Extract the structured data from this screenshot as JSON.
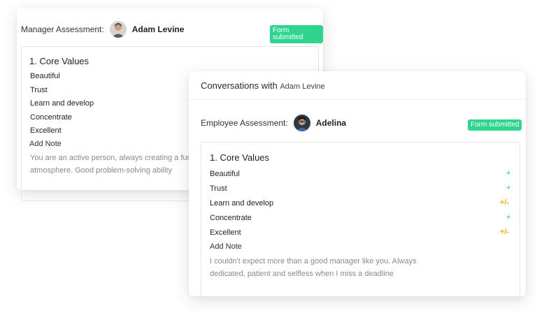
{
  "manager_card": {
    "label": "Manager Assessment:",
    "name": "Adam Levine",
    "badge": "Form submitted",
    "section_title": "1. Core Values",
    "values": [
      "Beautiful",
      "Trust",
      "Learn and develop",
      "Concentrate",
      "Excellent"
    ],
    "add_note": "Add Note",
    "note_line1": "You are an active person, always creating a fun",
    "note_line2": "atmosphere. Good problem-solving ability"
  },
  "conversation_card": {
    "title": "Conversations with",
    "title_name": "Adam Levine",
    "label": "Employee Assessment:",
    "name": "Adelina",
    "badge": "Form submitted",
    "section_title": "1. Core Values",
    "values": [
      {
        "label": "Beautiful",
        "score": "+"
      },
      {
        "label": "Trust",
        "score": "+"
      },
      {
        "label": "Learn and develop",
        "score": "+/-"
      },
      {
        "label": "Concentrate",
        "score": "+"
      },
      {
        "label": "Excellent",
        "score": "+/-"
      }
    ],
    "add_note": "Add Note",
    "note_line1": "I couldn't expect more than a good manager like you. Always",
    "note_line2": "dedicated, patient and selfless when I miss a deadline"
  },
  "colors": {
    "badge": "#2fd48f",
    "plus": "#31c27c",
    "mixed": "#e7b21c"
  }
}
